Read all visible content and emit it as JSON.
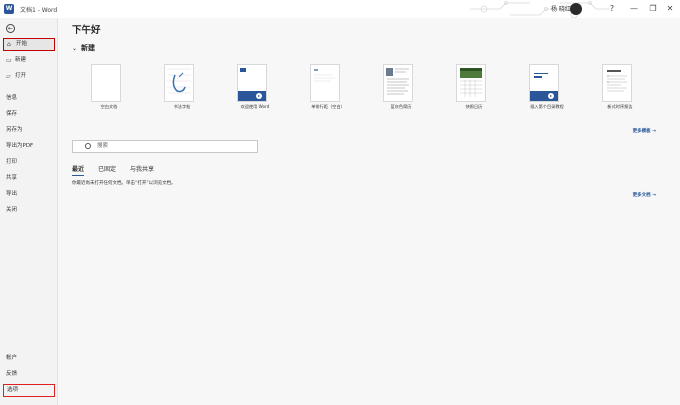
{
  "titlebar": {
    "app_icon": "W",
    "title": "文档1 - Word",
    "user": "杨 晓红",
    "controls": [
      "?",
      "—",
      "❐",
      "✕"
    ]
  },
  "sidebar": {
    "back_icon": "←",
    "top_items": [
      {
        "label": "开始",
        "icon": "home-icon",
        "glyph": "⌂"
      },
      {
        "label": "新建",
        "icon": "new-doc-icon",
        "glyph": "▭"
      },
      {
        "label": "打开",
        "icon": "open-folder-icon",
        "glyph": "▱"
      }
    ],
    "mid_items": [
      {
        "label": "信息"
      },
      {
        "label": "保存"
      },
      {
        "label": "另存为"
      },
      {
        "label": "导出为PDF"
      },
      {
        "label": "打印"
      },
      {
        "label": "共享"
      },
      {
        "label": "导出"
      },
      {
        "label": "关闭"
      }
    ],
    "bottom_items": [
      {
        "label": "帐户"
      },
      {
        "label": "反馈"
      },
      {
        "label": "选项"
      }
    ]
  },
  "main": {
    "greeting": "下午好",
    "new_section_label": "新建",
    "templates": [
      {
        "label": "空白文档"
      },
      {
        "label": "书法字帖"
      },
      {
        "label": "欢迎使用 Word"
      },
      {
        "label": "单排行距（空白）"
      },
      {
        "label": "蓝灰色简历"
      },
      {
        "label": "快照日历"
      },
      {
        "label": "插入第个目录教程"
      },
      {
        "label": "新式时序报告"
      }
    ],
    "more_templates": "更多模板 →",
    "search_placeholder": "搜索",
    "doc_tabs": [
      "最近",
      "已固定",
      "与我共享"
    ],
    "empty_hint": "你最近尚未打开任何文档。单击“打开”以浏览文档。",
    "more_docs": "更多文档 →"
  },
  "colors": {
    "word_blue": "#2b579a",
    "highlight_red": "#c00000"
  }
}
